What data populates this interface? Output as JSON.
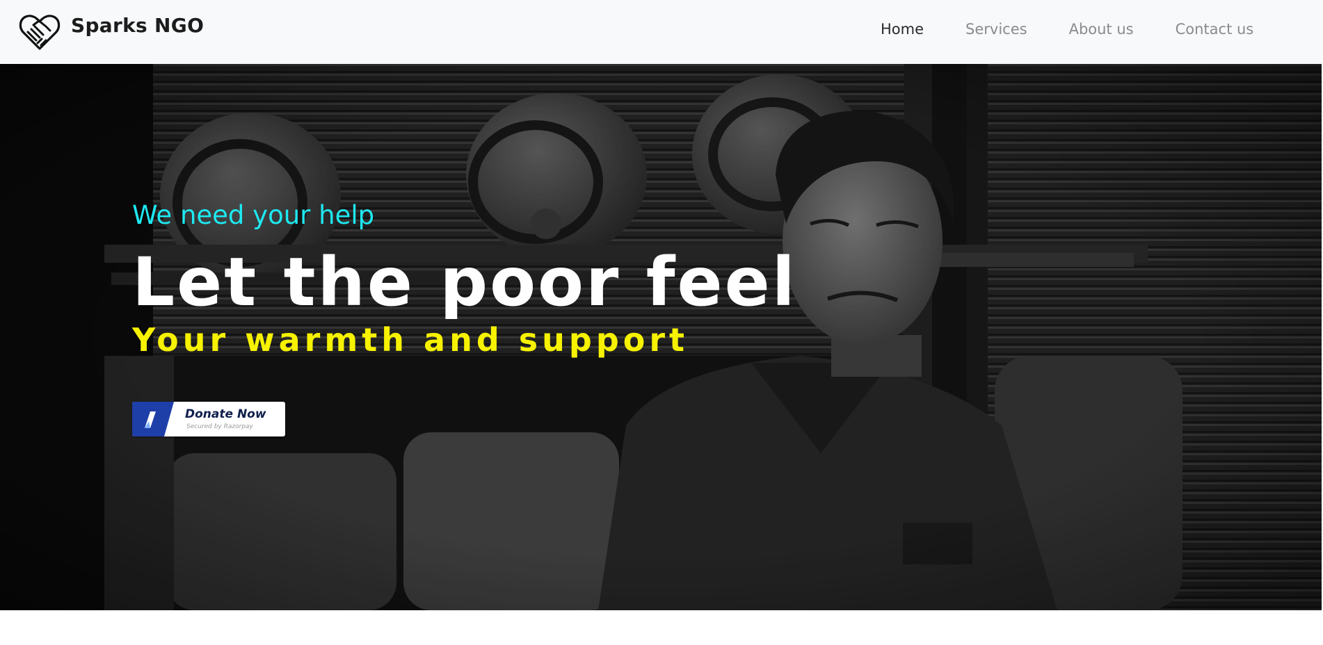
{
  "brand": {
    "name": "Sparks NGO",
    "logo_icon": "handshake-heart-icon"
  },
  "nav": {
    "items": [
      {
        "label": "Home",
        "active": true
      },
      {
        "label": "Services",
        "active": false
      },
      {
        "label": "About us",
        "active": false
      },
      {
        "label": "Contact us",
        "active": false
      }
    ]
  },
  "hero": {
    "tagline": "We need your help",
    "headline": "Let the poor feel",
    "subheadline": "Your warmth and support",
    "image_icon": "hero-photo",
    "donate_button": {
      "label": "Donate Now",
      "secured_text": "Secured by Razorpay",
      "icon": "razorpay-icon"
    }
  },
  "colors": {
    "navbar_bg": "#f7f9fb",
    "tagline": "#1ee8f0",
    "headline": "#ffffff",
    "subheadline": "#f6f200",
    "donate_accent": "#1e3ea8",
    "nav_active": "#2b2b2b",
    "nav_inactive": "#8a8a8a"
  }
}
